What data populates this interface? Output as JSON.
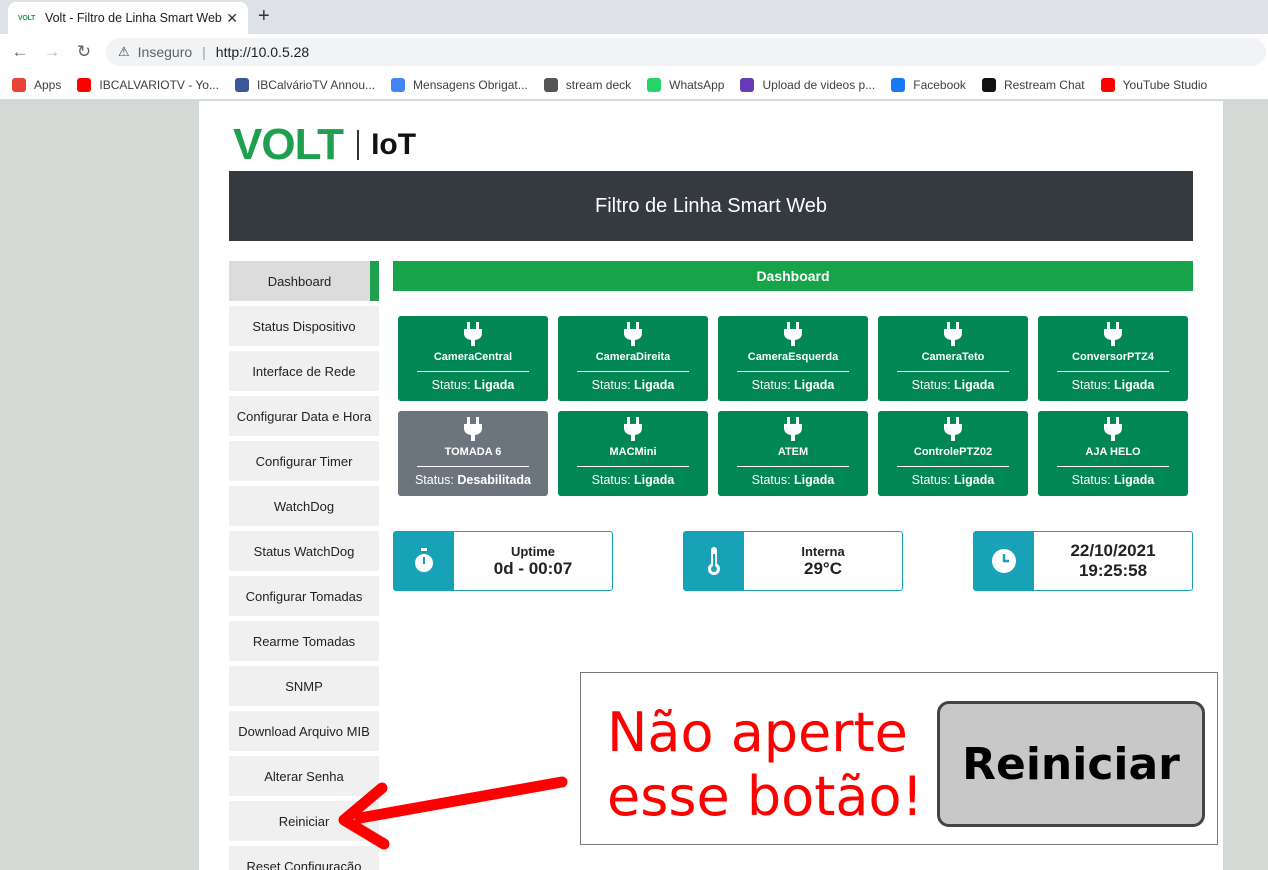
{
  "browser": {
    "tab_favicon": "VOLT",
    "tab_title": "Volt - Filtro de Linha Smart Web",
    "security": "Inseguro",
    "url": "http://10.0.5.28",
    "bookmarks": [
      {
        "label": "Apps",
        "color": "#ea4335"
      },
      {
        "label": "IBCALVARIOTV - Yo...",
        "color": "#ff0000"
      },
      {
        "label": "IBCalvárioTV Annou...",
        "color": "#3b5998"
      },
      {
        "label": "Mensagens Obrigat...",
        "color": "#4285f4"
      },
      {
        "label": "stream deck",
        "color": "#555555"
      },
      {
        "label": "WhatsApp",
        "color": "#25d366"
      },
      {
        "label": "Upload de videos p...",
        "color": "#673ab7"
      },
      {
        "label": "Facebook",
        "color": "#1877f2"
      },
      {
        "label": "Restream Chat",
        "color": "#111111"
      },
      {
        "label": "YouTube Studio",
        "color": "#ff0000"
      }
    ]
  },
  "brand": {
    "name": "VOLT",
    "suffix": "IoT"
  },
  "header": {
    "title": "Filtro de Linha Smart Web"
  },
  "sidebar": {
    "items": [
      {
        "label": "Dashboard"
      },
      {
        "label": "Status Dispositivo"
      },
      {
        "label": "Interface de Rede"
      },
      {
        "label": "Configurar Data e Hora"
      },
      {
        "label": "Configurar Timer"
      },
      {
        "label": "WatchDog"
      },
      {
        "label": "Status WatchDog"
      },
      {
        "label": "Configurar Tomadas"
      },
      {
        "label": "Rearme Tomadas"
      },
      {
        "label": "SNMP"
      },
      {
        "label": "Download Arquivo MIB"
      },
      {
        "label": "Alterar Senha"
      },
      {
        "label": "Reiniciar"
      },
      {
        "label": "Reset Configuração"
      }
    ]
  },
  "dashboard": {
    "title": "Dashboard",
    "status_prefix": "Status:",
    "outlets": [
      {
        "name": "CameraCentral",
        "status": "Ligada"
      },
      {
        "name": "CameraDireita",
        "status": "Ligada"
      },
      {
        "name": "CameraEsquerda",
        "status": "Ligada"
      },
      {
        "name": "CameraTeto",
        "status": "Ligada"
      },
      {
        "name": "ConversorPTZ4",
        "status": "Ligada"
      },
      {
        "name": "TOMADA 6",
        "status": "Desabilitada"
      },
      {
        "name": "MACMini",
        "status": "Ligada"
      },
      {
        "name": "ATEM",
        "status": "Ligada"
      },
      {
        "name": "ControlePTZ02",
        "status": "Ligada"
      },
      {
        "name": "AJA HELO",
        "status": "Ligada"
      }
    ],
    "uptime": {
      "label": "Uptime",
      "value": "0d - 00:07"
    },
    "temperature": {
      "label": "Interna",
      "value": "29°C"
    },
    "clock": {
      "date": "22/10/2021",
      "time": "19:25:58"
    }
  },
  "annotation": {
    "text": "Não aperte\nesse botão!",
    "button_label": "Reiniciar",
    "colors": {
      "text": "#ff0000",
      "arrow": "#ff0000"
    }
  },
  "colors": {
    "green": "#008753",
    "green_bar": "#16a34a",
    "header": "#343a40",
    "info": "#17a2b8",
    "disabled": "#6c757d"
  }
}
